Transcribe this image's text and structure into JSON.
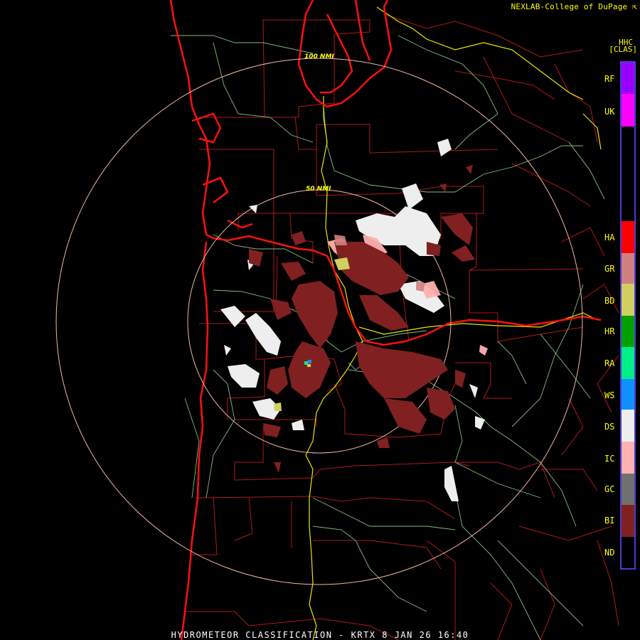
{
  "header": {
    "credit": "NEXLAB-College of DuPage",
    "credit_icon": "external-link-icon",
    "product_code": "HHC",
    "product_class": "[CLAS]"
  },
  "rings": {
    "inner_label": "50 NMI",
    "outer_label": "100 NMI"
  },
  "legend": {
    "items": [
      {
        "code": "RF",
        "color": "#9900ff"
      },
      {
        "code": "UK",
        "color": "#ff00ff"
      },
      {
        "code": "HA",
        "color": "#ff0000"
      },
      {
        "code": "GR",
        "color": "#d08080"
      },
      {
        "code": "BD",
        "color": "#d0d060"
      },
      {
        "code": "HR",
        "color": "#00a000"
      },
      {
        "code": "RA",
        "color": "#00ee88"
      },
      {
        "code": "WS",
        "color": "#1090ff"
      },
      {
        "code": "DS",
        "color": "#eeeeee"
      },
      {
        "code": "IC",
        "color": "#ffb0b0"
      },
      {
        "code": "GC",
        "color": "#707070"
      },
      {
        "code": "BI",
        "color": "#802020"
      },
      {
        "code": "ND",
        "color": "#000000"
      }
    ]
  },
  "footer": {
    "title": "HYDROMETEOR CLASSIFICATION - KRTX 8 JAN 26 16:40"
  }
}
